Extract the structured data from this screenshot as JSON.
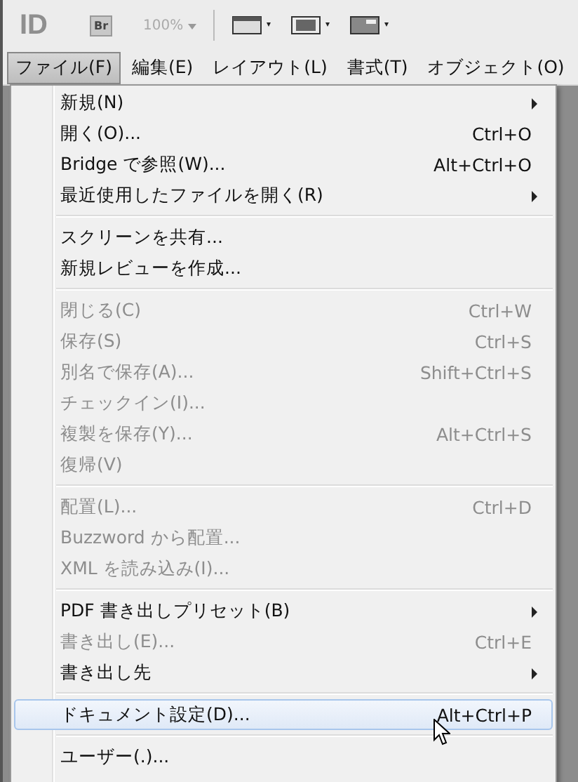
{
  "toolbar": {
    "logo": "ID",
    "bridge": "Br",
    "zoom": "100%"
  },
  "menu_bar": [
    {
      "label": "ファイル(F)",
      "selected": true
    },
    {
      "label": "編集(E)",
      "selected": false
    },
    {
      "label": "レイアウト(L)",
      "selected": false
    },
    {
      "label": "書式(T)",
      "selected": false
    },
    {
      "label": "オブジェクト(O)",
      "selected": false
    }
  ],
  "menu_groups": [
    {
      "items": [
        {
          "label": "新規(N)",
          "submenu": true,
          "disabled": false,
          "selected": false
        },
        {
          "label": "開く(O)...",
          "shortcut": "Ctrl+O",
          "disabled": false,
          "selected": false
        },
        {
          "label": "Bridge で参照(W)...",
          "shortcut": "Alt+Ctrl+O",
          "disabled": false,
          "selected": false
        },
        {
          "label": "最近使用したファイルを開く(R)",
          "submenu": true,
          "disabled": false,
          "selected": false
        }
      ]
    },
    {
      "items": [
        {
          "label": "スクリーンを共有...",
          "disabled": false,
          "selected": false
        },
        {
          "label": "新規レビューを作成...",
          "disabled": false,
          "selected": false
        }
      ]
    },
    {
      "items": [
        {
          "label": "閉じる(C)",
          "shortcut": "Ctrl+W",
          "disabled": true,
          "selected": false
        },
        {
          "label": "保存(S)",
          "shortcut": "Ctrl+S",
          "disabled": true,
          "selected": false
        },
        {
          "label": "別名で保存(A)...",
          "shortcut": "Shift+Ctrl+S",
          "disabled": true,
          "selected": false
        },
        {
          "label": "チェックイン(I)...",
          "disabled": true,
          "selected": false
        },
        {
          "label": "複製を保存(Y)...",
          "shortcut": "Alt+Ctrl+S",
          "disabled": true,
          "selected": false
        },
        {
          "label": "復帰(V)",
          "disabled": true,
          "selected": false
        }
      ]
    },
    {
      "items": [
        {
          "label": "配置(L)...",
          "shortcut": "Ctrl+D",
          "disabled": true,
          "selected": false
        },
        {
          "label": "Buzzword から配置...",
          "disabled": true,
          "selected": false
        },
        {
          "label": "XML を読み込み(I)...",
          "disabled": true,
          "selected": false
        }
      ]
    },
    {
      "items": [
        {
          "label": "PDF 書き出しプリセット(B)",
          "submenu": true,
          "disabled": false,
          "selected": false
        },
        {
          "label": "書き出し(E)...",
          "shortcut": "Ctrl+E",
          "disabled": true,
          "selected": false
        },
        {
          "label": "書き出し先",
          "submenu": true,
          "disabled": false,
          "selected": false
        }
      ]
    },
    {
      "items": [
        {
          "label": "ドキュメント設定(D)...",
          "shortcut": "Alt+Ctrl+P",
          "disabled": false,
          "selected": true
        }
      ]
    },
    {
      "items": [
        {
          "label": "ユーザー(.)...",
          "disabled": false,
          "selected": false
        }
      ]
    }
  ]
}
